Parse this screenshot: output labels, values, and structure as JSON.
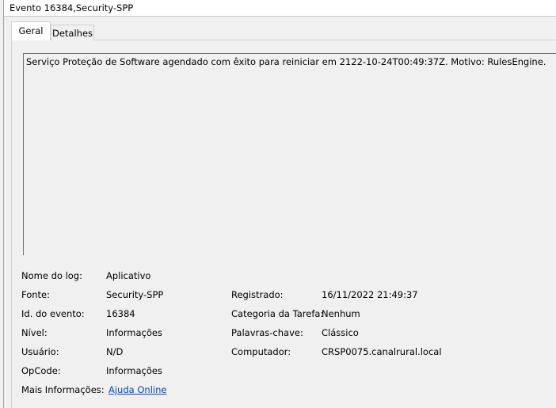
{
  "window": {
    "title": "Evento 16384,Security-SPP"
  },
  "tabs": [
    {
      "label": "Geral"
    },
    {
      "label": "Detalhes"
    }
  ],
  "message": "Serviço Proteção de Software agendado com êxito para reiniciar em 2122-10-24T00:49:37Z. Motivo: RulesEngine.",
  "details": {
    "log_name_label": "Nome do log:",
    "log_name_value": "Aplicativo",
    "source_label": "Fonte:",
    "source_value": "Security-SPP",
    "event_id_label": "Id. do evento:",
    "event_id_value": "16384",
    "level_label": "Nível:",
    "level_value": "Informações",
    "user_label": "Usuário:",
    "user_value": "N/D",
    "opcode_label": "OpCode:",
    "opcode_value": "Informações",
    "more_info_label": "Mais Informações:",
    "more_info_link": "Ajuda Online",
    "logged_label": "Registrado:",
    "logged_value": "16/11/2022 21:49:37",
    "task_category_label": "Categoria da Tarefa:",
    "task_category_value": "Nenhum",
    "keywords_label": "Palavras-chave:",
    "keywords_value": "Clássico",
    "computer_label": "Computador:",
    "computer_value": "CRSP0075.canalrural.local"
  }
}
